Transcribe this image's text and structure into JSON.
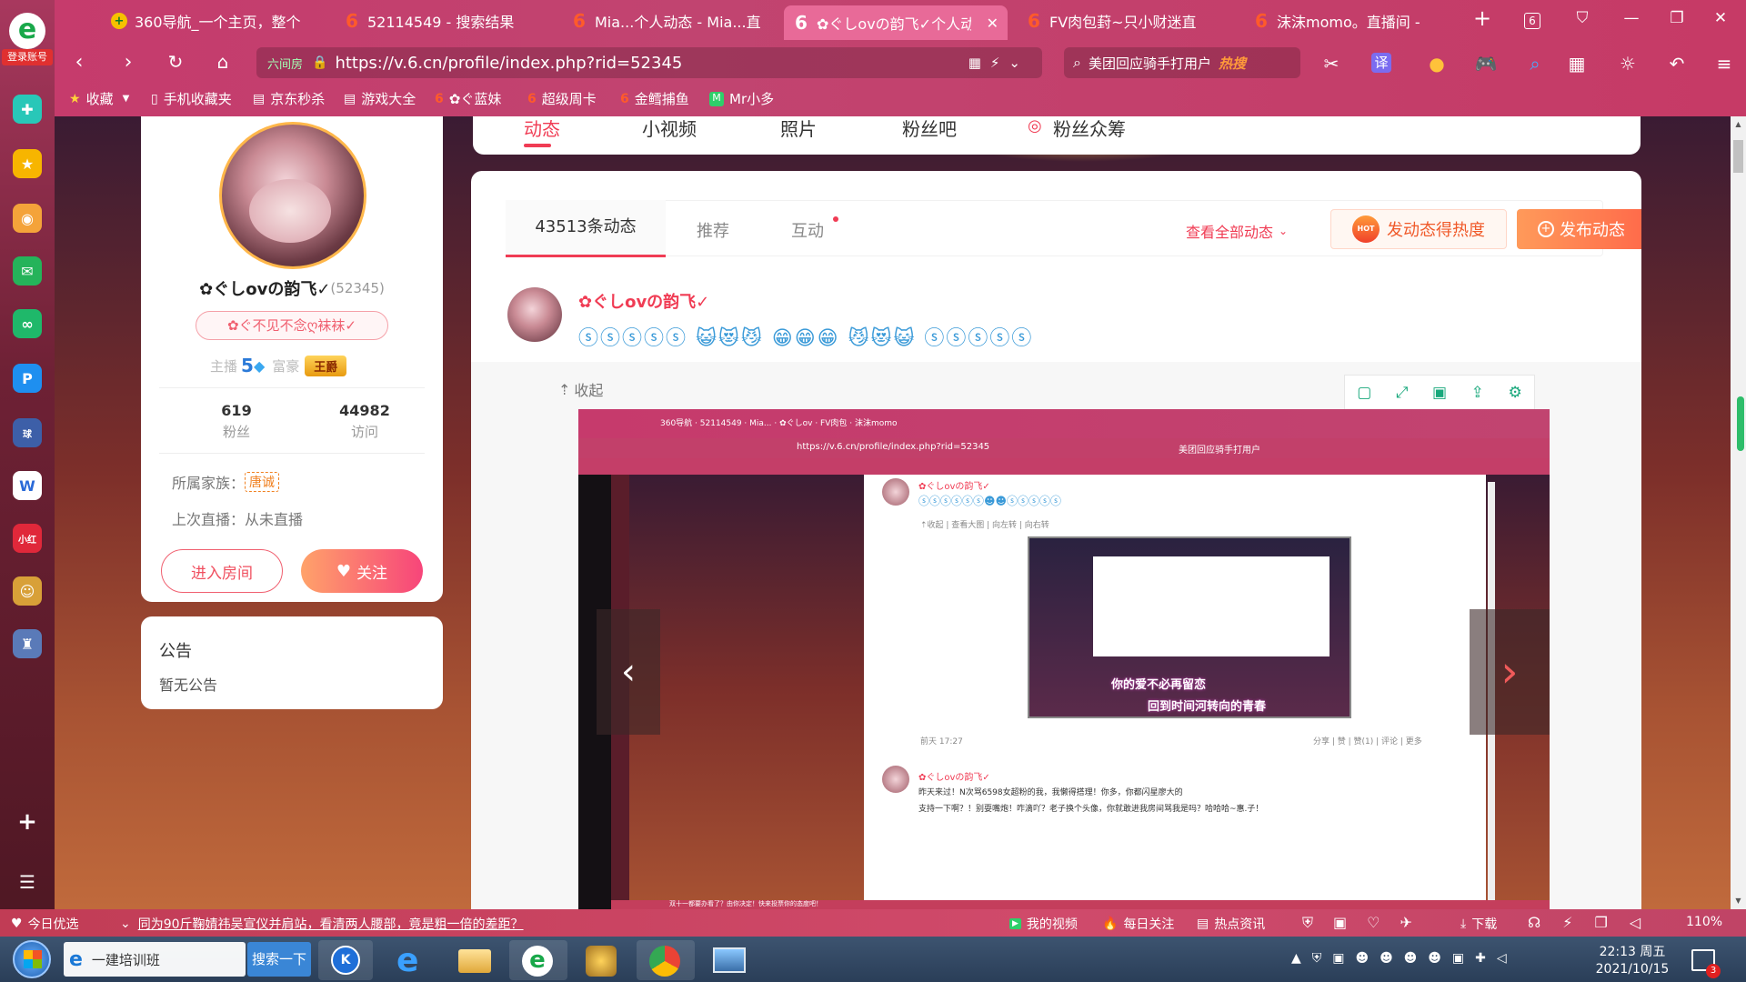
{
  "sidebar": {
    "login": "登录账号"
  },
  "tabs": [
    {
      "label": "360导航_一个主页，整个"
    },
    {
      "label": "52114549 - 搜索结果"
    },
    {
      "label": "Mia...个人动态 - Mia...直"
    },
    {
      "label": "✿ぐしovの韵飞✓个人动"
    },
    {
      "label": "FV肉包葑~只小财迷直"
    },
    {
      "label": "沫沫momo。直播间 -"
    }
  ],
  "tab_count": "6",
  "address": {
    "badge": "六间房",
    "url": "https://v.6.cn/profile/index.php?rid=52345"
  },
  "search": {
    "text": "美团回应骑手打用户",
    "hot": "热搜"
  },
  "toolbar": {
    "translate": "译"
  },
  "bookmarks": [
    {
      "label": "收藏"
    },
    {
      "label": "手机收藏夹"
    },
    {
      "label": "京东秒杀"
    },
    {
      "label": "游戏大全"
    },
    {
      "label": "✿ぐ蓝妹"
    },
    {
      "label": "超级周卡"
    },
    {
      "label": "金鳕捕鱼"
    },
    {
      "label": "Mr小多"
    }
  ],
  "topnav": {
    "items": [
      "动态",
      "小视频",
      "照片",
      "粉丝吧",
      "粉丝众筹"
    ]
  },
  "profile": {
    "name": "✿ぐしovの韵飞✓",
    "rid": "(52345)",
    "badge": "✿ぐ不见不念ღ袜袜✓",
    "anchor_label": "主播",
    "anchor_level": "5",
    "rich_label": "富豪",
    "rich_badge": "王爵",
    "fans_count": "619",
    "fans_label": "粉丝",
    "visit_count": "44982",
    "visit_label": "访问",
    "family_label": "所属家族：",
    "family_value": "唐诚",
    "last_live_label": "上次直播：",
    "last_live_value": "从未直播",
    "enter_room": "进入房间",
    "follow": "关注"
  },
  "notice": {
    "title": "公告",
    "content": "暂无公告"
  },
  "feed": {
    "tabs": [
      "43513条动态",
      "推荐",
      "互动"
    ],
    "view_all": "查看全部动态",
    "heat_button": "发动态得热度",
    "hot_icon": "HOT",
    "publish_button": "发布动态",
    "post_author": "✿ぐしovの韵飞✓",
    "post_text": "ⓢⓢⓢⓢⓢ 😺😻😼 😁😁😁 😼😻😺 ⓢⓢⓢⓢⓢ",
    "collapse": "收起"
  },
  "inner": {
    "url": "https://v.6.cn/profile/index.php?rid=52345",
    "search": "美团回应骑手打用户",
    "post_author": "✿ぐしovの韵飞✓",
    "post_time": "前天 17:27",
    "actions": [
      "收起",
      "查看大图",
      "向左转",
      "向右转"
    ],
    "post_stats": "分享 | 赞 | 赞(1) | 评论 | 更多",
    "post2_author": "✿ぐしovの韵飞✓",
    "post2_line1": "昨天来过！N次骂6598女超粉的我，我懒得搭理！你多，你都闪星廖大的",
    "post2_line2": "支持一下啊？！别耍嘴炮！咋滴吖？老子换个头像，你就敢进我房间骂我是吗？哈哈哈~惠.子！",
    "caption1": "你的爱不必再留恋",
    "caption2": "回到时间河转向的青春",
    "bottom_news": "双十一都要办看了？由你决定！快来投票你的态度吧！"
  },
  "statusbar": {
    "left": "今日优选",
    "news": "同为90斤鞠婧祎吴宣仪并肩站，看清两人腰部，竟是粗一倍的差距？",
    "my_video": "我的视频",
    "daily": "每日关注",
    "hot_news": "热点资讯",
    "download": "下载",
    "zoom": "110%"
  },
  "taskbar": {
    "ie_label": "一建培训班",
    "search_btn": "搜索一下",
    "time": "22:13 周五",
    "date": "2021/10/15",
    "notif": "3"
  }
}
